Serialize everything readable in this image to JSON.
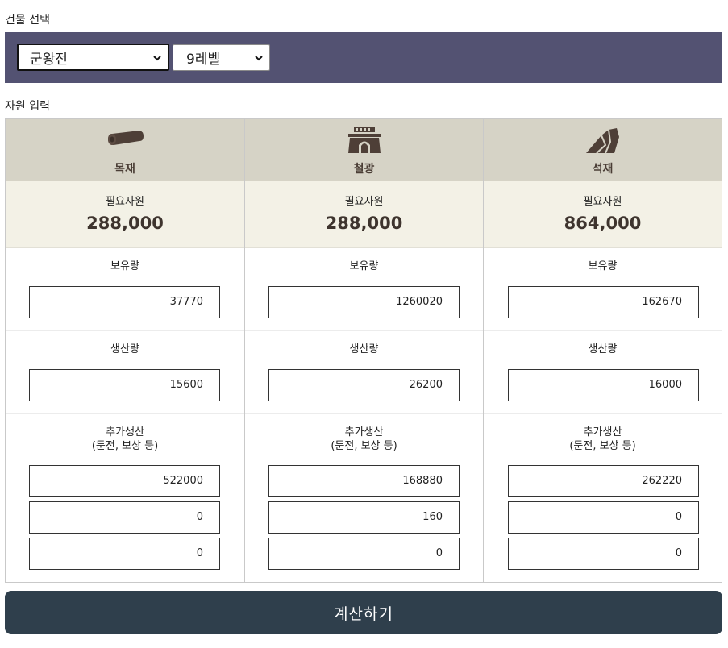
{
  "building_section": {
    "label": "건물 선택",
    "building_select": "군왕전",
    "level_select": "9레벨"
  },
  "resource_section": {
    "label": "자원 입력"
  },
  "labels": {
    "required": "필요자원",
    "owned": "보유량",
    "production": "생산량",
    "extra_line1": "추가생산",
    "extra_line2": "(둔전, 보상 등)"
  },
  "resources": [
    {
      "name": "목재",
      "icon": "log-icon",
      "required": "288,000",
      "owned": "37770",
      "production": "15600",
      "extra": [
        "522000",
        "0",
        "0"
      ]
    },
    {
      "name": "철광",
      "icon": "mine-icon",
      "required": "288,000",
      "owned": "1260020",
      "production": "26200",
      "extra": [
        "168880",
        "160",
        "0"
      ]
    },
    {
      "name": "석재",
      "icon": "stone-icon",
      "required": "864,000",
      "owned": "162670",
      "production": "16000",
      "extra": [
        "262220",
        "0",
        "0"
      ]
    }
  ],
  "calculate_button": "계산하기",
  "colors": {
    "select_bar": "#535272",
    "header_bg": "#d6d3c6",
    "required_bg": "#f3f1e6",
    "button_bg": "#2f3f4c",
    "icon_brown": "#4e3f37"
  }
}
